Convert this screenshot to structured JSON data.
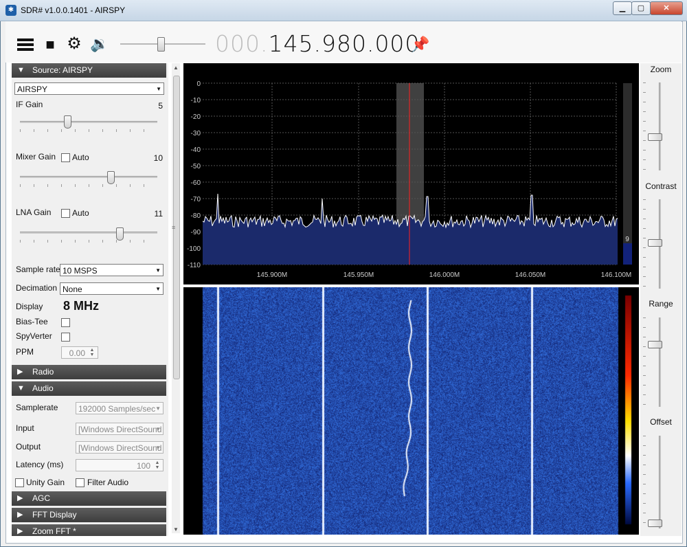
{
  "window": {
    "title": "SDR# v1.0.0.1401 - AIRSPY",
    "app_icon": "sdrsharp-logo-icon",
    "controls": [
      "minimize-icon",
      "maximize-icon",
      "close-icon"
    ]
  },
  "toolbar": {
    "menu_icon": "hamburger-menu-icon",
    "stop_icon": "stop-icon",
    "settings_icon": "gear-icon",
    "audio_icon": "speaker-icon",
    "volume_level": 0.48,
    "frequency_prefix": "000.",
    "frequency_main": "145.980.000",
    "pin_icon": "pin-icon"
  },
  "left_panel": {
    "source": {
      "header": "Source: AIRSPY",
      "device": "AIRSPY",
      "if_gain_label": "IF Gain",
      "if_gain_value": "5",
      "if_gain_level": 0.33,
      "mixer_gain_label": "Mixer Gain",
      "mixer_auto_label": "Auto",
      "mixer_gain_value": "10",
      "mixer_gain_level": 0.67,
      "lna_gain_label": "LNA Gain",
      "lna_auto_label": "Auto",
      "lna_gain_value": "11",
      "lna_gain_level": 0.73,
      "sample_rate_label": "Sample rate",
      "sample_rate_value": "10 MSPS",
      "decimation_label": "Decimation",
      "decimation_value": "None",
      "display_label": "Display",
      "display_value": "8 MHz",
      "bias_tee_label": "Bias-Tee",
      "spyverter_label": "SpyVerter",
      "ppm_label": "PPM",
      "ppm_value": "0.00"
    },
    "radio": {
      "header": "Radio"
    },
    "audio": {
      "header": "Audio",
      "samplerate_label": "Samplerate",
      "samplerate_value": "192000 Samples/sec",
      "input_label": "Input",
      "input_value": "[Windows DirectSound",
      "output_label": "Output",
      "output_value": "[Windows DirectSound",
      "latency_label": "Latency (ms)",
      "latency_value": "100",
      "unity_gain_label": "Unity Gain",
      "filter_audio_label": "Filter Audio"
    },
    "agc": {
      "header": "AGC"
    },
    "fft_display": {
      "header": "FFT Display"
    },
    "zoom_fft": {
      "header": "Zoom FFT *"
    }
  },
  "spectrum": {
    "y_ticks": [
      "0",
      "-10",
      "-20",
      "-30",
      "-40",
      "-50",
      "-60",
      "-70",
      "-80",
      "-90",
      "-100",
      "-110"
    ],
    "x_ticks": [
      "145.900M",
      "145.950M",
      "146.000M",
      "146.050M",
      "146.100M"
    ],
    "level_value": "9",
    "colors": {
      "background": "#000000",
      "trace": "#ffffff",
      "fill": "#1b2a6b",
      "cursor": "#ff2020"
    }
  },
  "right_panel": {
    "zoom_label": "Zoom",
    "contrast_label": "Contrast",
    "range_label": "Range",
    "offset_label": "Offset"
  }
}
